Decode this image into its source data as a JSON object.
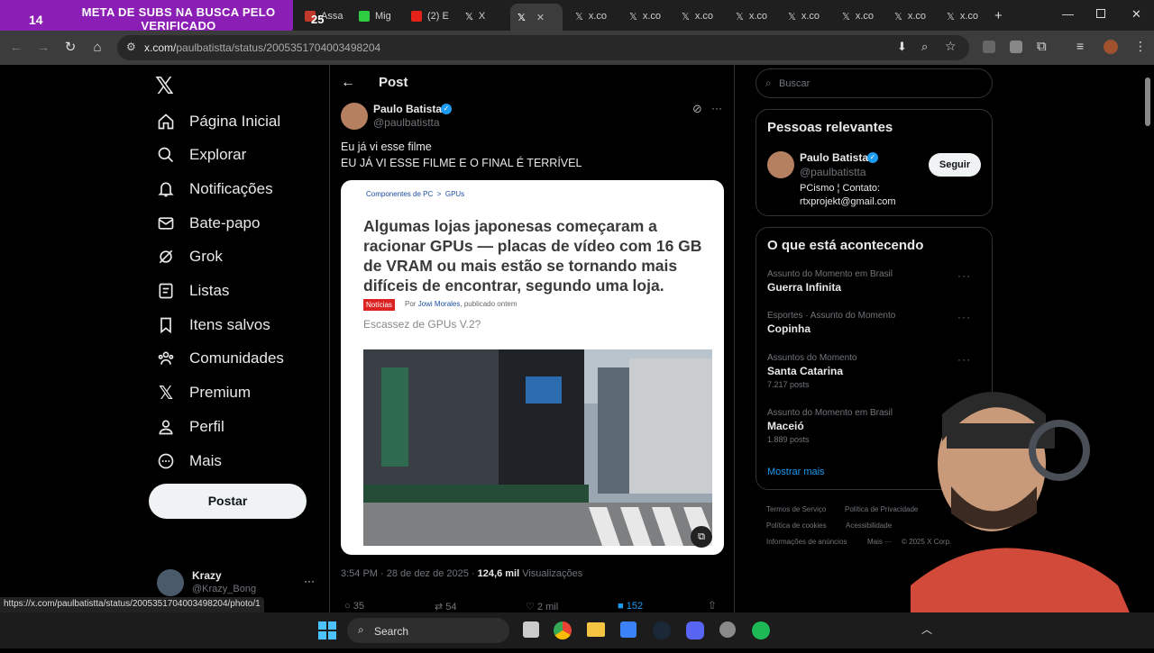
{
  "overlay": {
    "sub_count": "14",
    "banner": "META DE SUBS NA BUSCA PELO VERIFICADO",
    "goal": "25"
  },
  "browser": {
    "tabs": [
      {
        "label": "Assa",
        "color": "#c0392b"
      },
      {
        "label": "Mig",
        "color": "#2ecc40"
      },
      {
        "label": "(2) E",
        "color": "#e62117"
      },
      {
        "label": "X",
        "color": "#444"
      },
      {
        "label": "",
        "color": "#444",
        "active": true
      },
      {
        "label": "x.co",
        "color": "#444"
      },
      {
        "label": "x.co",
        "color": "#444"
      },
      {
        "label": "x.co",
        "color": "#444"
      },
      {
        "label": "x.co",
        "color": "#444"
      },
      {
        "label": "x.co",
        "color": "#444"
      },
      {
        "label": "x.co",
        "color": "#444"
      },
      {
        "label": "x.co",
        "color": "#444"
      },
      {
        "label": "x.co",
        "color": "#444"
      }
    ],
    "url_host": "x.com/",
    "url_path": "paulbatistta/status/2005351704003498204",
    "status_url": "https://x.com/paulbatistta/status/2005351704003498204/photo/1"
  },
  "nav": {
    "items": [
      {
        "label": "Página Inicial",
        "icon": "home-icon"
      },
      {
        "label": "Explorar",
        "icon": "search-icon"
      },
      {
        "label": "Notificações",
        "icon": "bell-icon"
      },
      {
        "label": "Bate-papo",
        "icon": "mail-icon"
      },
      {
        "label": "Grok",
        "icon": "grok-icon"
      },
      {
        "label": "Listas",
        "icon": "list-icon"
      },
      {
        "label": "Itens salvos",
        "icon": "bookmark-icon"
      },
      {
        "label": "Comunidades",
        "icon": "people-icon"
      },
      {
        "label": "Premium",
        "icon": "x-logo-icon"
      },
      {
        "label": "Perfil",
        "icon": "person-icon"
      },
      {
        "label": "Mais",
        "icon": "more-circle-icon"
      }
    ],
    "post_button": "Postar",
    "account": {
      "name": "Krazy",
      "handle": "@Krazy_Bong"
    }
  },
  "post": {
    "header": "Post",
    "author": {
      "name": "Paulo Batista",
      "handle": "@paulbatistta"
    },
    "text_line1": "Eu já vi esse filme",
    "text_line2": "EU JÁ VI ESSE FILME E O FINAL É TERRÍVEL",
    "article": {
      "crumb1": "Componentes de PC",
      "crumb_sep": ">",
      "crumb2": "GPUs",
      "headline": "Algumas lojas japonesas começaram a racionar GPUs — placas de vídeo com 16 GB de VRAM ou mais estão se tornando mais difíceis de encontrar, segundo uma loja.",
      "tag": "Notícias",
      "byline_prefix": "Por",
      "byline_author": "Jowi Morales",
      "byline_suffix": ", publicado ontem",
      "subtitle": "Escassez de GPUs V.2?"
    },
    "time": "3:54 PM · 28 de dez de 2025 ·",
    "views_count": "124,6 mil",
    "views_label": "Visualizações",
    "stats": {
      "replies": "35",
      "reposts": "54",
      "likes": "2 mil",
      "bookmarks": "152"
    }
  },
  "right": {
    "search_placeholder": "Buscar",
    "relevant_title": "Pessoas relevantes",
    "relevant_person": {
      "name": "Paulo Batista",
      "handle": "@paulbatistta",
      "bio1": "PCismo ¦ Contato:",
      "bio2": "rtxprojekt@gmail.com",
      "follow": "Seguir"
    },
    "trending_title": "O que está acontecendo",
    "trends": [
      {
        "category": "Assunto do Momento em Brasil",
        "name": "Guerra Infinita",
        "count": ""
      },
      {
        "category": "Esportes · Assunto do Momento",
        "name": "Copinha",
        "count": ""
      },
      {
        "category": "Assuntos do Momento",
        "name": "Santa Catarina",
        "count": "7.217 posts"
      },
      {
        "category": "Assunto do Momento em Brasil",
        "name": "Maceió",
        "count": "1.889 posts"
      }
    ],
    "show_more": "Mostrar mais",
    "footer": [
      "Termos de Serviço",
      "Política de Privacidade",
      "Política de cookies",
      "Acessibilidade",
      "Informações de anúncios",
      "Mais ···",
      "© 2025 X Corp."
    ]
  },
  "taskbar": {
    "search_label": "Search"
  },
  "colors": {
    "verified": "#1d9bf0",
    "x_bg": "#000000",
    "overlay": "#8b1eb5"
  }
}
